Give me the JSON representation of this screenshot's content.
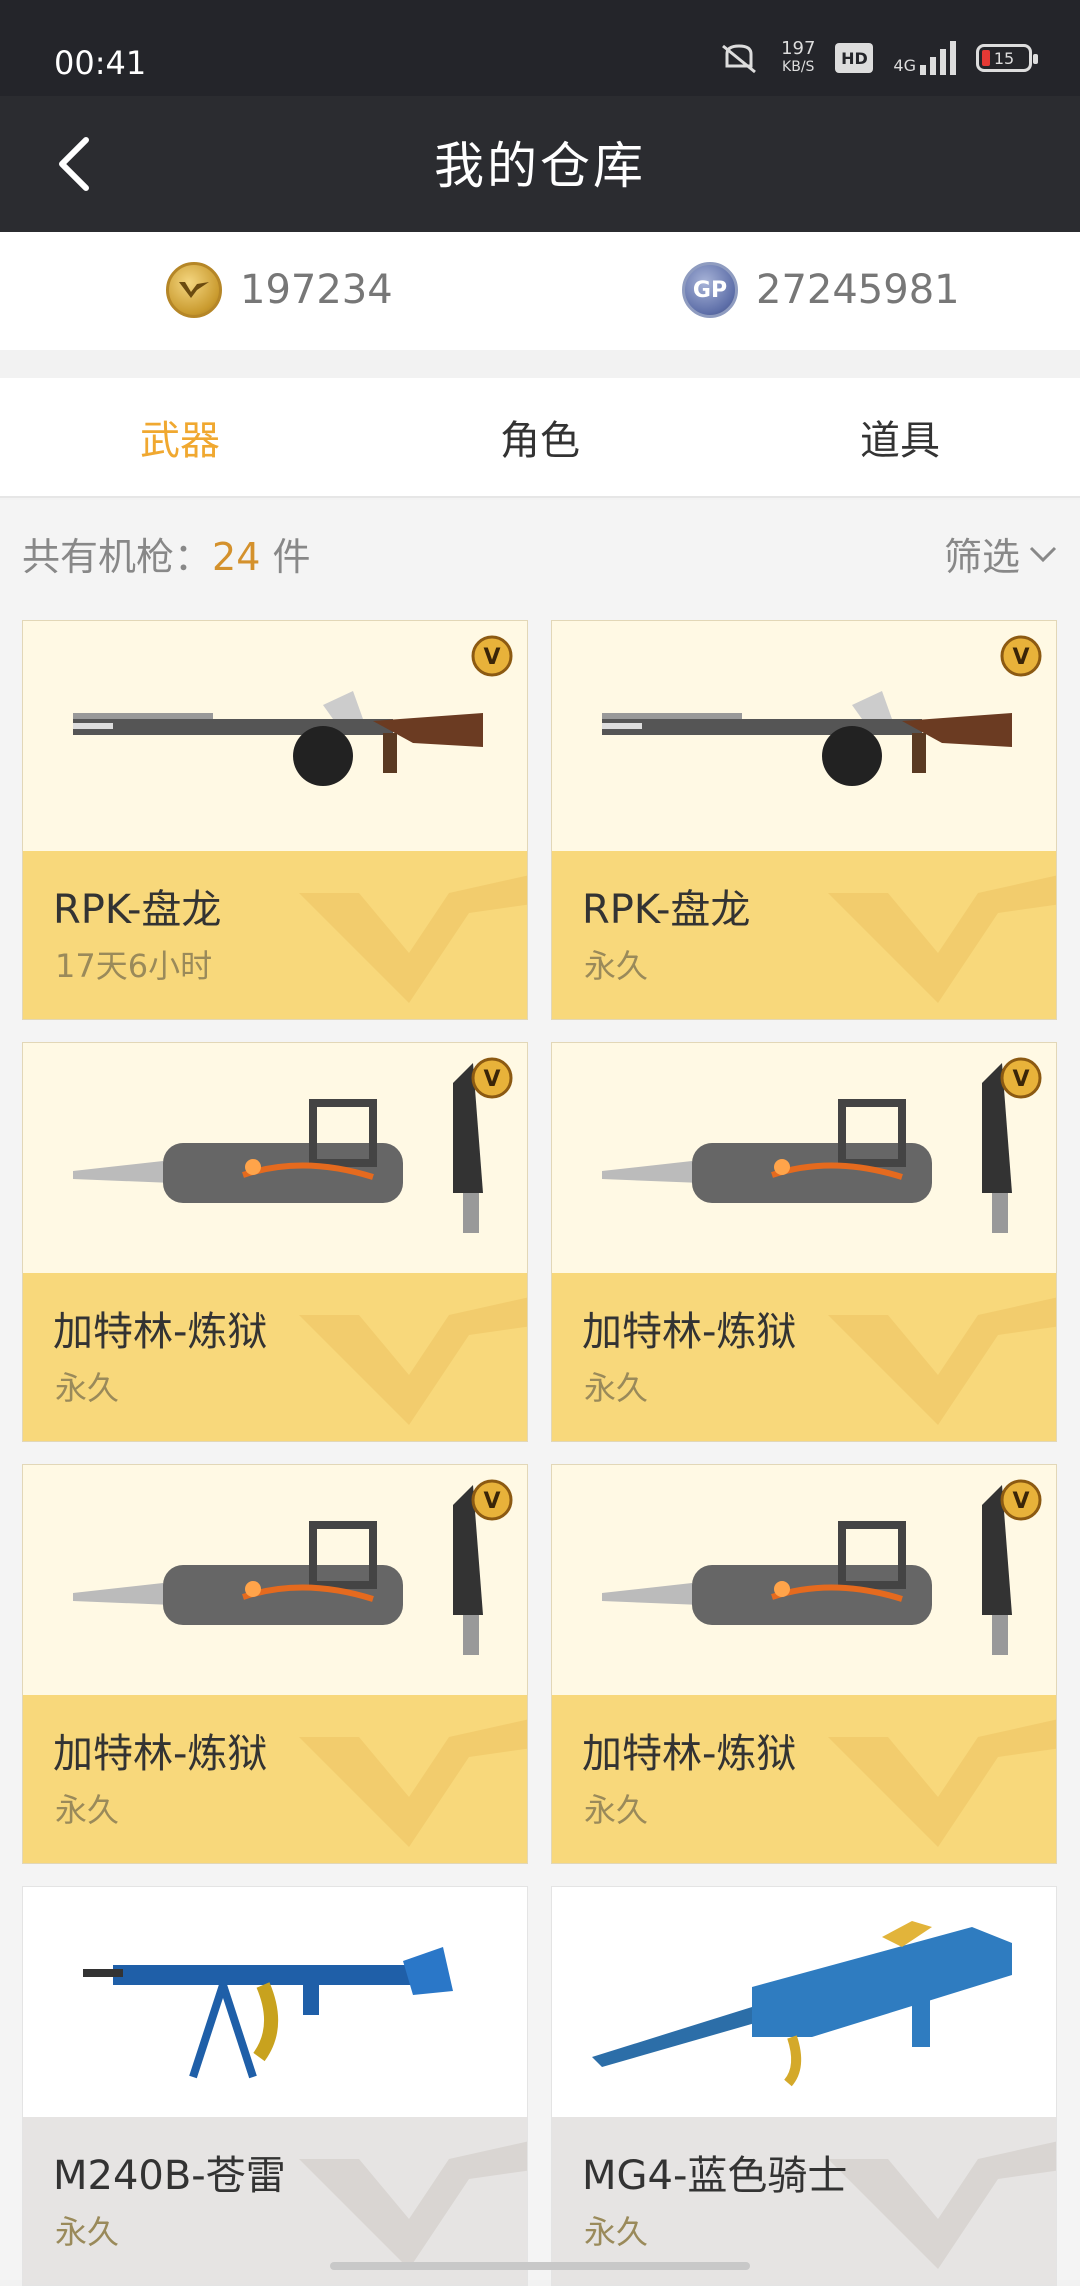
{
  "status_bar": {
    "time": "00:41",
    "net_speed_value": "197",
    "net_speed_unit": "KB/S",
    "hd": "HD",
    "network": "4G",
    "battery": "15"
  },
  "nav": {
    "title": "我的仓库"
  },
  "currency": {
    "cf_points": "197234",
    "gp_points": "27245981",
    "cf_icon": "cf-coin-icon",
    "gp_icon": "gp-coin-icon",
    "gp_label": "GP"
  },
  "tabs": [
    {
      "label": "武器",
      "active": true
    },
    {
      "label": "角色"
    },
    {
      "label": "道具"
    }
  ],
  "summary": {
    "prefix": "共有机枪：",
    "count": "24",
    "suffix": " 件",
    "filter_label": "筛选"
  },
  "colors": {
    "accent": "#f0a830",
    "card_band": "#f8d87b",
    "nav_bg": "#2b2c30"
  },
  "items": [
    {
      "name": "RPK-盘龙",
      "duration": "17天6小时"
    },
    {
      "name": "RPK-盘龙",
      "duration": "永久"
    },
    {
      "name": "加特林-炼狱",
      "duration": "永久"
    },
    {
      "name": "加特林-炼狱",
      "duration": "永久"
    },
    {
      "name": "加特林-炼狱",
      "duration": "永久"
    },
    {
      "name": "加特林-炼狱",
      "duration": "永久"
    },
    {
      "name": "M240B-苍雷",
      "duration": "永久"
    },
    {
      "name": "MG4-蓝色骑士",
      "duration": "永久"
    }
  ]
}
